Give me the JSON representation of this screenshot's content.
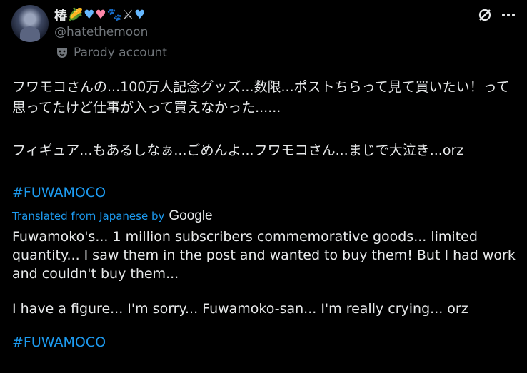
{
  "author": {
    "display_name": "椿",
    "name_emojis": [
      {
        "glyph": "🌽",
        "icon": "corn-icon"
      },
      {
        "glyph": "♥",
        "icon": "blue-heart-icon"
      },
      {
        "glyph": "♥",
        "icon": "pink-heart-icon"
      },
      {
        "glyph": "🐾",
        "icon": "paw-icon"
      },
      {
        "glyph": "⚔",
        "icon": "crossed-swords-icon"
      },
      {
        "glyph": "♥",
        "icon": "blue-heart-icon"
      }
    ],
    "handle": "@hatethemoon",
    "badge": "Parody account"
  },
  "post": {
    "jp_line1": "フワモコさんの...100万人記念グッズ...数限...ポストちらって見て買いたい！って思ってたけど仕事が入って買えなかった......",
    "jp_line2": "フィギュア...もあるしなぁ...ごめんよ...フワモコさん...まじで大泣き...orz",
    "hashtag": "#FUWAMOCO",
    "translated_label": "Translated from Japanese by",
    "translator": "Google",
    "en_paragraph1": "Fuwamoko's... 1 million subscribers commemorative goods... limited quantity... I saw them in the post and wanted to buy them! But I had work and couldn't buy them...",
    "en_paragraph2": "I have a figure... I'm sorry... Fuwamoko-san... I'm really crying... orz",
    "translated_hashtag": "#FUWAMOCO"
  },
  "colors": {
    "background": "#000000",
    "text": "#e7e9ea",
    "secondary": "#71767b",
    "link": "#1d9bf0"
  }
}
